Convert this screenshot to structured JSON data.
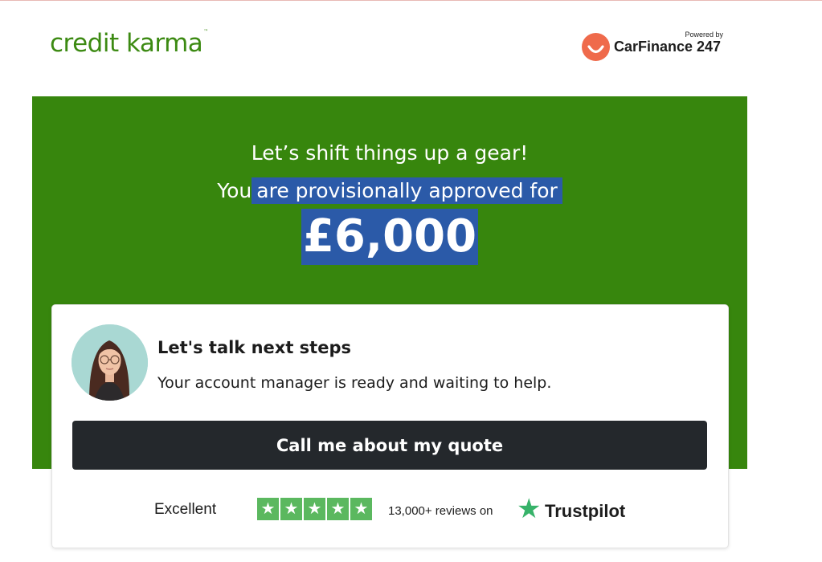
{
  "header": {
    "logo_text": "credit karma",
    "logo_tm": "™",
    "partner_label": "Powered by",
    "partner_name": "CarFinance 247",
    "brand_color": "#3c8a12",
    "partner_color": "#ef6a4b"
  },
  "hero": {
    "line1": "Let’s shift things up a gear!",
    "line2_prefix": "You",
    "line2_highlight": "are provisionally approved for",
    "amount": "£6,000",
    "background": "#37860d",
    "highlight_color": "#2b5aa8"
  },
  "card": {
    "title": "Let's talk next steps",
    "subtitle": "Your account manager is ready and waiting to help.",
    "cta_label": "Call me about my quote",
    "avatar_icon": "account-manager-avatar"
  },
  "rating": {
    "label": "Excellent",
    "stars": 5,
    "reviews_text": "13,000+ reviews on",
    "provider": "Trustpilot",
    "provider_icon": "trustpilot-star-icon",
    "star_glyph": "★"
  }
}
